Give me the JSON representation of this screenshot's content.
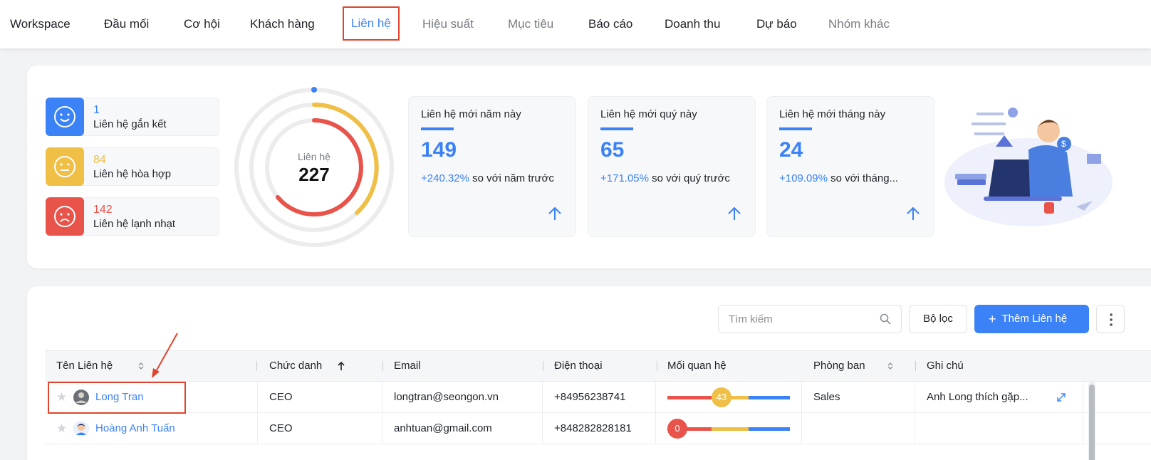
{
  "nav": {
    "tabs": [
      {
        "label": "Workspace"
      },
      {
        "label": "Đầu mối"
      },
      {
        "label": "Cơ hội"
      },
      {
        "label": "Khách hàng"
      },
      {
        "label": "Liên hệ"
      },
      {
        "label": "Hiệu suất"
      },
      {
        "label": "Mục tiêu"
      },
      {
        "label": "Báo cáo"
      },
      {
        "label": "Doanh thu"
      },
      {
        "label": "Dự báo"
      },
      {
        "label": "Nhóm khác"
      }
    ],
    "active": "Liên hệ"
  },
  "summary": {
    "moods": [
      {
        "count": "1",
        "label": "Liên hệ gắn kết",
        "color": "#3b82f6"
      },
      {
        "count": "84",
        "label": "Liên hệ hòa hợp",
        "color": "#f0bf45"
      },
      {
        "count": "142",
        "label": "Liên hệ lạnh nhạt",
        "color": "#e8534a"
      }
    ],
    "donut": {
      "caption": "Liên hệ",
      "total": "227"
    },
    "stats": [
      {
        "title": "Liên hệ mới năm này",
        "value": "149",
        "pct": "+240.32%",
        "compare": " so với năm trước"
      },
      {
        "title": "Liên hệ mới quý này",
        "value": "65",
        "pct": "+171.05%",
        "compare": " so với quý trước"
      },
      {
        "title": "Liên hệ mới tháng này",
        "value": "24",
        "pct": "+109.09%",
        "compare": " so với tháng..."
      }
    ]
  },
  "toolbar": {
    "search_placeholder": "Tìm kiếm",
    "filter_label": "Bộ lọc",
    "add_label": "Thêm Liên hệ"
  },
  "table": {
    "columns": [
      {
        "label": "Tên Liên hệ",
        "sort": "sortable"
      },
      {
        "label": "Chức danh",
        "sort": "asc"
      },
      {
        "label": "Email"
      },
      {
        "label": "Điện thoại"
      },
      {
        "label": "Mối quan hệ"
      },
      {
        "label": "Phòng ban",
        "sort": "sortable"
      },
      {
        "label": "Ghi chú"
      }
    ],
    "rows": [
      {
        "name": "Long Tran",
        "title": "CEO",
        "email": "longtran@seongon.vn",
        "phone": "+84956238741",
        "relationship": "43",
        "relationship_level": 0.43,
        "relationship_color": "#f0bf45",
        "department": "Sales",
        "note": "Anh Long thích gặp..."
      },
      {
        "name": "Hoàng Anh Tuấn",
        "title": "CEO",
        "email": "anhtuan@gmail.com",
        "phone": "+848282828181",
        "relationship": "0",
        "relationship_level": 0.0,
        "relationship_color": "#e8534a",
        "department": "",
        "note": ""
      }
    ]
  },
  "colors": {
    "accent": "#3b82f6",
    "highlight": "#e0442e",
    "warm": "#f0bf45",
    "cold": "#e8534a"
  }
}
